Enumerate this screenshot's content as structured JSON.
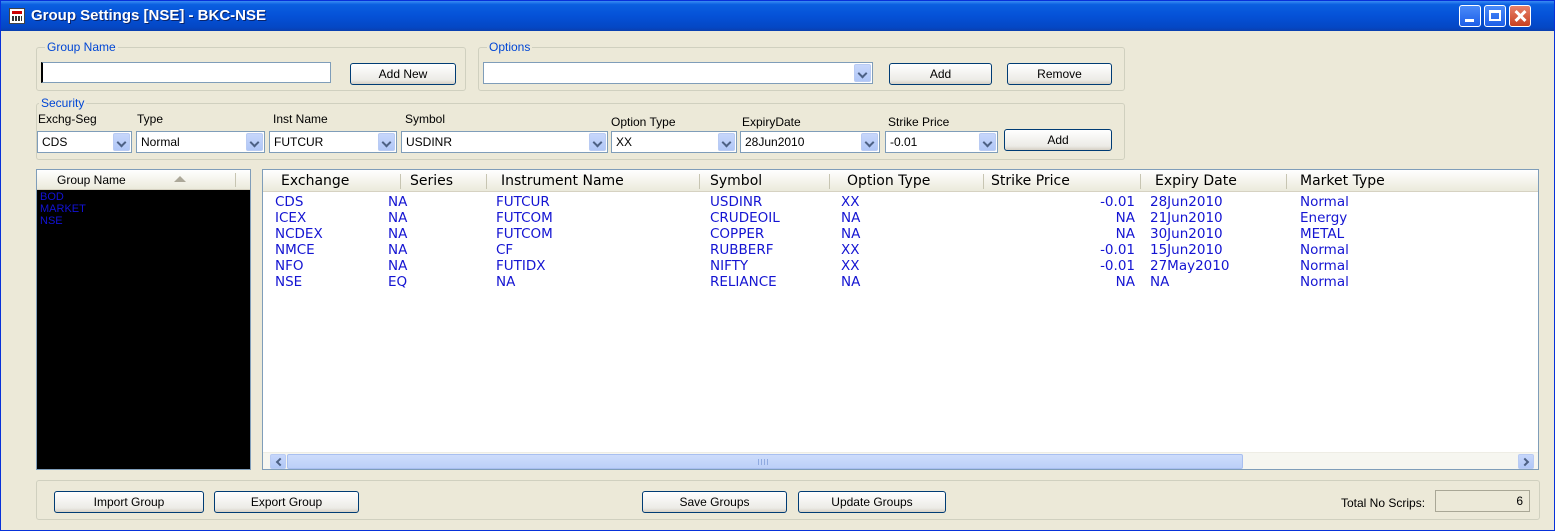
{
  "window": {
    "title": "Group Settings [NSE] - BKC-NSE"
  },
  "group_name_box": {
    "legend": "Group Name",
    "input_value": "",
    "add_new_label": "Add New"
  },
  "options_box": {
    "legend": "Options",
    "select_value": "",
    "add_label": "Add",
    "remove_label": "Remove"
  },
  "security_box": {
    "legend": "Security",
    "labels": {
      "exchg_seg": "Exchg-Seg",
      "type": "Type",
      "inst_name": "Inst Name",
      "symbol": "Symbol",
      "option_type": "Option Type",
      "expiry_date": "ExpiryDate",
      "strike_price": "Strike Price"
    },
    "values": {
      "exchg_seg": "CDS",
      "type": "Normal",
      "inst_name": "FUTCUR",
      "symbol": "USDINR",
      "option_type": "XX",
      "expiry_date": "28Jun2010",
      "strike_price": "-0.01"
    },
    "add_label": "Add"
  },
  "group_list": {
    "header": "Group Name",
    "items": [
      "BOD",
      "MARKET",
      "NSE"
    ]
  },
  "table": {
    "columns": [
      "Exchange",
      "Series",
      "Instrument Name",
      "Symbol",
      "Option Type",
      "Strike Price",
      "Expiry Date",
      "Market Type"
    ],
    "rows": [
      [
        "CDS",
        "NA",
        "FUTCUR",
        "USDINR",
        "XX",
        "-0.01",
        "28Jun2010",
        "Normal"
      ],
      [
        "ICEX",
        "NA",
        "FUTCOM",
        "CRUDEOIL",
        "NA",
        "NA",
        "21Jun2010",
        "Energy"
      ],
      [
        "NCDEX",
        "NA",
        "FUTCOM",
        "COPPER",
        "NA",
        "NA",
        "30Jun2010",
        "METAL"
      ],
      [
        "NMCE",
        "NA",
        "CF",
        "RUBBERF",
        "XX",
        "-0.01",
        "15Jun2010",
        "Normal"
      ],
      [
        "NFO",
        "NA",
        "FUTIDX",
        "NIFTY",
        "XX",
        "-0.01",
        "27May2010",
        "Normal"
      ],
      [
        "NSE",
        "EQ",
        "NA",
        "RELIANCE",
        "NA",
        "NA",
        "NA",
        "Normal"
      ]
    ]
  },
  "footer": {
    "import_label": "Import Group",
    "export_label": "Export Group",
    "save_label": "Save Groups",
    "update_label": "Update Groups",
    "total_label": "Total No Scrips:",
    "total_value": "6"
  },
  "colors": {
    "title_bar": "#0551d7",
    "legend_text": "#0046d5",
    "row_text": "#1414d2",
    "group_list_bg": "#000000",
    "window_bg": "#ece9d8"
  }
}
